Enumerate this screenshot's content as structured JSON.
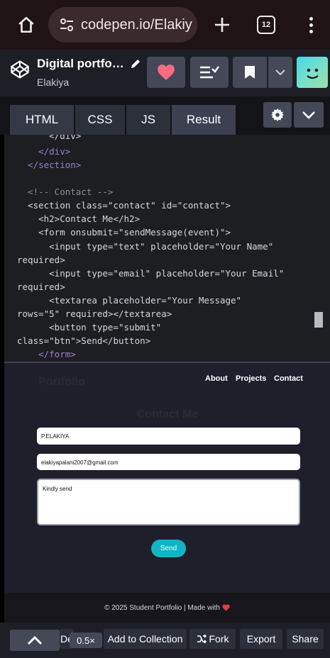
{
  "browser": {
    "url": "codepen.io/Elakiy",
    "tab_count": "12"
  },
  "pen": {
    "title": "Digital portfo…",
    "author": "Elakiya"
  },
  "editor_tabs": [
    "HTML",
    "CSS",
    "JS",
    "Result"
  ],
  "code_lines": [
    "      </div>",
    "    </div>",
    "  </section>",
    "",
    "  <!-- Contact -->",
    "  <section class=\"contact\" id=\"contact\">",
    "    <h2>Contact Me</h2>",
    "    <form onsubmit=\"sendMessage(event)\">",
    "      <input type=\"text\" placeholder=\"Your Name\"",
    "required>",
    "      <input type=\"email\" placeholder=\"Your Email\"",
    "required>",
    "      <textarea placeholder=\"Your Message\"",
    "rows=\"5\" required></textarea>",
    "      <button type=\"submit\"",
    "class=\"btn\">Send</button>",
    "    </form>"
  ],
  "preview": {
    "nav_logo": "Portfolio",
    "nav_links": [
      "About",
      "Projects",
      "Contact"
    ],
    "heading": "Contact Me",
    "name_value": "P.ELAKIYA",
    "email_value": "elakiyapalani2007@gmail.com",
    "message_value": "Kindly send",
    "send_label": "Send",
    "footer_text": "© 2025 Student Portfolio | Made with"
  },
  "bottom_bar": {
    "de_label": "De",
    "zoom": "0.5×",
    "add_to_collection": "Add to Collection",
    "fork": "Fork",
    "export": "Export",
    "share": "Share"
  },
  "colors": {
    "accent_teal": "#0fb5c5",
    "heart_red": "#ff6b81"
  }
}
